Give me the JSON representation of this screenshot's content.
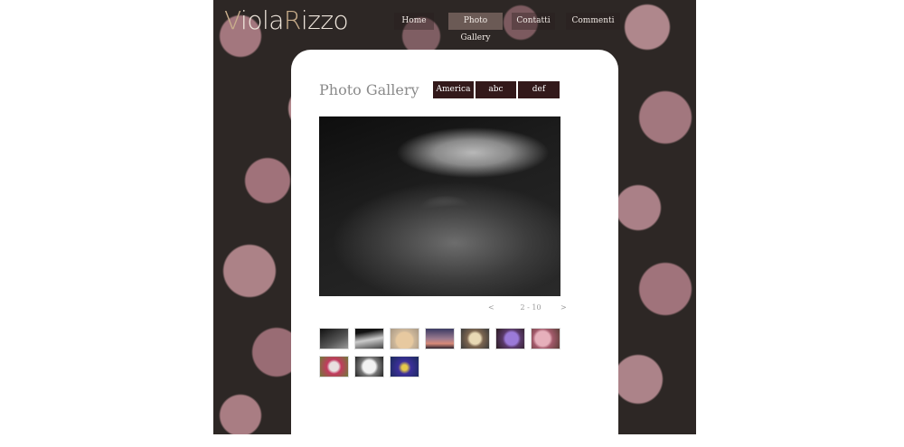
{
  "site": {
    "logo_first": "V",
    "logo_mid1": "iola",
    "logo_cap": "R",
    "logo_mid2": "izzo"
  },
  "nav": {
    "home": "Home",
    "gallery": "Photo Gallery",
    "contatti": "Contatti",
    "commenti": "Commenti"
  },
  "page": {
    "title": "Photo Gallery"
  },
  "categories": [
    "America",
    "abc",
    "def"
  ],
  "pager": {
    "prev": "<",
    "count": "2 - 10",
    "next": ">"
  },
  "colors": {
    "accent": "#33191a",
    "nav_active": "#6b5a55",
    "logo_cap": "#c9ae8c"
  },
  "thumbnails": [
    "bw-shoulder-thumb",
    "bw-shoulder-thumb-2",
    "lion-cub-thumb",
    "sunset-thumb",
    "flower-thumb",
    "purple-flower-thumb",
    "magnolia-thumb",
    "tulip-thumb",
    "white-flower-thumb",
    "pansy-thumb"
  ]
}
